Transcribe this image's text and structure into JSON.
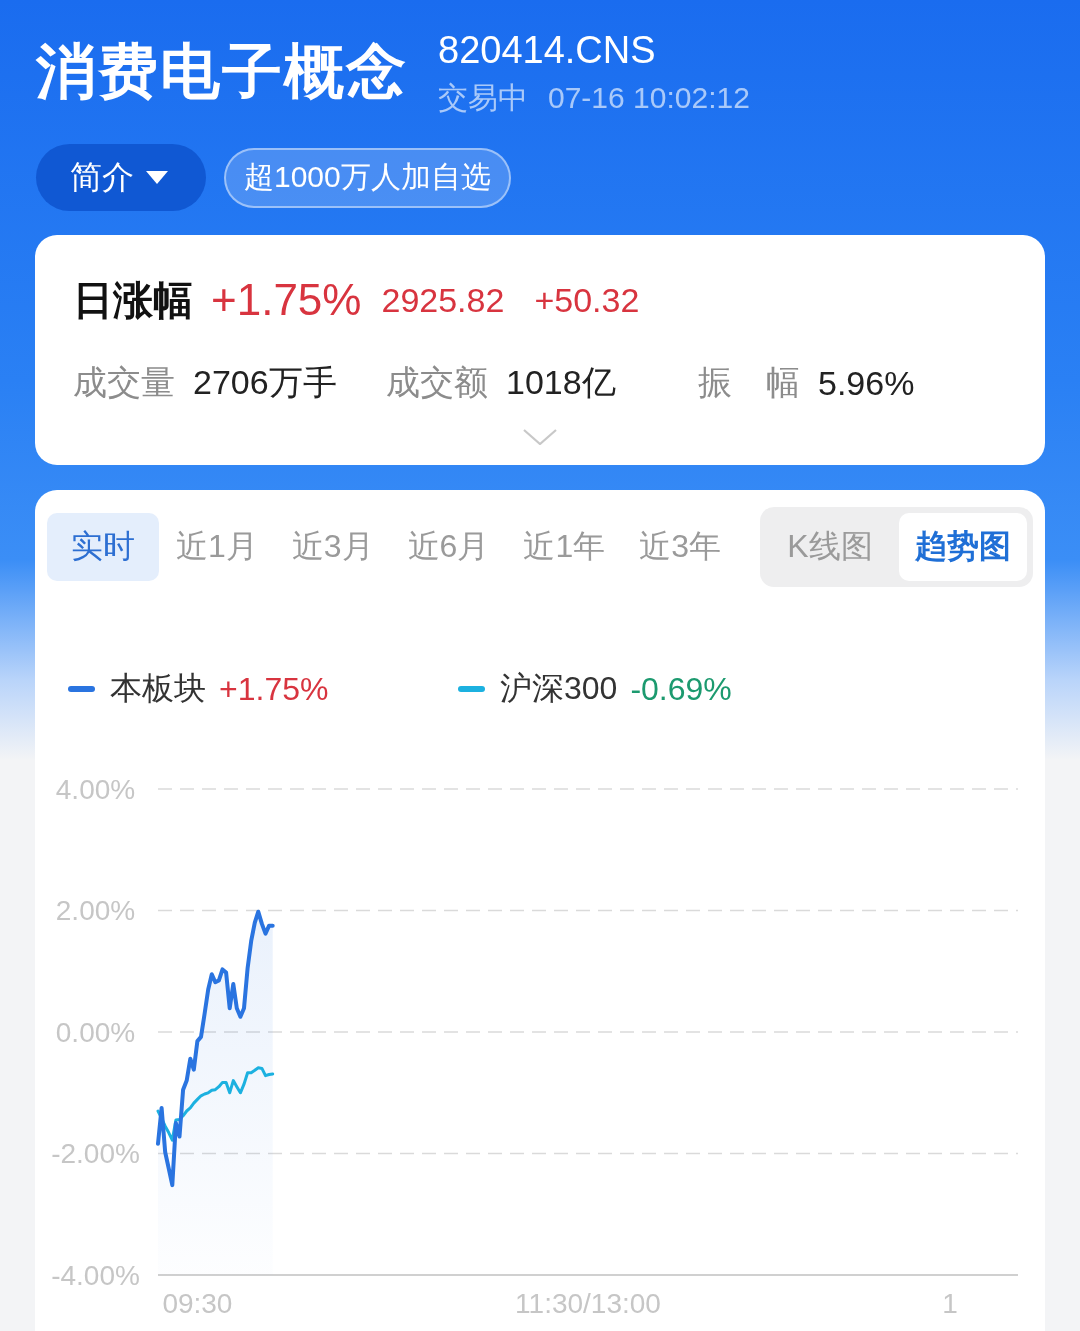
{
  "header": {
    "title": "消费电子概念",
    "code": "820414.CNS",
    "status": "交易中",
    "timestamp": "07-16 10:02:12"
  },
  "actions": {
    "intro_button": "简介",
    "watchlist_badge": "超1000万人加自选"
  },
  "quote": {
    "label": "日涨幅",
    "change_percent": "+1.75%",
    "price": "2925.82",
    "change": "+50.32",
    "color": "#d8343f",
    "stats": [
      {
        "label": "成交量",
        "value": "2706万手"
      },
      {
        "label": "成交额",
        "value": "1018亿"
      },
      {
        "label": "振　幅",
        "value": "5.96%"
      }
    ],
    "expanded": false
  },
  "chart": {
    "range_tabs": [
      {
        "label": "实时",
        "selected": true
      },
      {
        "label": "近1月",
        "selected": false
      },
      {
        "label": "近3月",
        "selected": false
      },
      {
        "label": "近6月",
        "selected": false
      },
      {
        "label": "近1年",
        "selected": false
      },
      {
        "label": "近3年",
        "selected": false
      }
    ],
    "view_toggle": [
      {
        "label": "K线图",
        "selected": false
      },
      {
        "label": "趋势图",
        "selected": true
      }
    ],
    "legend_changes": [
      {
        "text": "+1.75%",
        "color": "#d8343f"
      },
      {
        "text": "-0.69%",
        "color": "#1c9a6f"
      }
    ],
    "chart_data": {
      "type": "line",
      "grid": true,
      "categories": [
        null,
        null,
        null,
        null,
        null,
        null,
        null,
        null,
        null,
        null,
        null,
        "09:30",
        null,
        null,
        null,
        null,
        null,
        null,
        null,
        null,
        null,
        null,
        null,
        null,
        null,
        null,
        null,
        null,
        null,
        null,
        null,
        null,
        null,
        null,
        null,
        null,
        null,
        null,
        null,
        null,
        null,
        null,
        null,
        null,
        null,
        null,
        null,
        null,
        null,
        null,
        null,
        null,
        null,
        null,
        null,
        null,
        null,
        null,
        null,
        null,
        null,
        null,
        null,
        null,
        null,
        null,
        null,
        null,
        null,
        null,
        null,
        null,
        null,
        null,
        null,
        null,
        null,
        null,
        null,
        null,
        null,
        null,
        null,
        null,
        null,
        null,
        null,
        null,
        null,
        null,
        null,
        null,
        null,
        null,
        null,
        null,
        null,
        null,
        null,
        null,
        null,
        null,
        null,
        null,
        null,
        null,
        null,
        null,
        null,
        null,
        null,
        null,
        null,
        null,
        null,
        null,
        null,
        null,
        null,
        null,
        "11:30/13:00",
        null,
        null,
        null,
        null,
        null,
        null,
        null,
        null,
        null,
        null,
        null,
        null,
        null,
        null,
        null,
        null,
        null,
        null,
        null,
        null,
        null,
        null,
        null,
        null,
        null,
        null,
        null,
        null,
        null,
        null,
        null,
        null,
        null,
        null,
        null,
        null,
        null,
        null,
        null,
        null,
        null,
        null,
        null,
        null,
        null,
        null,
        null,
        null,
        null,
        null,
        null,
        null,
        null,
        null,
        null,
        null,
        null,
        null,
        null,
        null,
        null,
        null,
        null,
        null,
        null,
        null,
        null,
        null,
        null,
        null,
        null,
        null,
        null,
        null,
        null,
        null,
        null,
        null,
        null,
        null,
        null,
        null,
        null,
        null,
        null,
        null,
        null,
        null,
        null,
        null,
        null,
        null,
        null,
        null,
        null,
        null,
        null,
        null,
        null,
        null,
        "1",
        null,
        null,
        null,
        null,
        null,
        null,
        null,
        null,
        null,
        null,
        null,
        null,
        null,
        null,
        null,
        null,
        null,
        null,
        null
      ],
      "ylim": [
        -4,
        4
      ],
      "yticks": [
        {
          "value": 4,
          "label": "4.00%"
        },
        {
          "value": 2,
          "label": "2.00%"
        },
        {
          "value": 0,
          "label": "0.00%"
        },
        {
          "value": -2,
          "label": "-2.00%"
        },
        {
          "value": -4,
          "label": "-4.00%"
        }
      ],
      "series": [
        {
          "name": "本板块",
          "color": "#2a74e0",
          "values": [
            -1.84,
            -1.25,
            -1.98,
            -2.25,
            -2.52,
            -1.5,
            -1.72,
            -0.95,
            -0.8,
            -0.44,
            -0.62,
            -0.15,
            -0.08,
            0.3,
            0.7,
            0.95,
            0.82,
            0.85,
            1.03,
            0.98,
            0.39,
            0.79,
            0.39,
            0.25,
            0.39,
            1.05,
            1.5,
            1.8,
            1.98,
            1.78,
            1.62,
            1.75,
            1.75,
            null,
            null,
            null,
            null,
            null,
            null,
            null,
            null,
            null,
            null,
            null,
            null,
            null,
            null,
            null,
            null,
            null,
            null,
            null,
            null,
            null,
            null,
            null,
            null,
            null,
            null,
            null,
            null,
            null,
            null,
            null,
            null,
            null,
            null,
            null,
            null,
            null,
            null,
            null,
            null,
            null,
            null,
            null,
            null,
            null,
            null,
            null,
            null,
            null,
            null,
            null,
            null,
            null,
            null,
            null,
            null,
            null,
            null,
            null,
            null,
            null,
            null,
            null,
            null,
            null,
            null,
            null,
            null,
            null,
            null,
            null,
            null,
            null,
            null,
            null,
            null,
            null,
            null,
            null,
            null,
            null,
            null,
            null,
            null,
            null,
            null,
            null,
            null,
            null,
            null,
            null,
            null,
            null,
            null,
            null,
            null,
            null,
            null,
            null,
            null,
            null,
            null,
            null,
            null,
            null,
            null,
            null,
            null,
            null,
            null,
            null,
            null,
            null,
            null,
            null,
            null,
            null,
            null,
            null,
            null,
            null,
            null,
            null,
            null,
            null,
            null,
            null,
            null,
            null,
            null,
            null,
            null,
            null,
            null,
            null,
            null,
            null,
            null,
            null,
            null,
            null,
            null,
            null,
            null,
            null,
            null,
            null,
            null,
            null,
            null,
            null,
            null,
            null,
            null,
            null,
            null,
            null,
            null,
            null,
            null,
            null,
            null,
            null,
            null,
            null,
            null,
            null,
            null,
            null,
            null,
            null,
            null,
            null,
            null,
            null,
            null,
            null,
            null,
            null,
            null,
            null,
            null,
            null,
            null,
            null,
            null,
            null,
            null,
            null,
            null,
            null,
            null,
            null,
            null,
            null,
            null,
            null,
            null,
            null,
            null,
            null,
            null,
            null,
            null,
            null,
            null,
            null,
            null
          ]
        },
        {
          "name": "沪深300",
          "color": "#1cb1e0",
          "values": [
            -1.3,
            -1.42,
            -1.55,
            -1.66,
            -1.78,
            -1.45,
            -1.44,
            -1.38,
            -1.3,
            -1.25,
            -1.17,
            -1.11,
            -1.05,
            -1.02,
            -1.0,
            -0.96,
            -0.95,
            -0.9,
            -0.83,
            -0.83,
            -1.0,
            -0.8,
            -0.9,
            -1.0,
            -0.86,
            -0.67,
            -0.67,
            -0.63,
            -0.59,
            -0.6,
            -0.72,
            -0.7,
            -0.69,
            null,
            null,
            null,
            null,
            null,
            null,
            null,
            null,
            null,
            null,
            null,
            null,
            null,
            null,
            null,
            null,
            null,
            null,
            null,
            null,
            null,
            null,
            null,
            null,
            null,
            null,
            null,
            null,
            null,
            null,
            null,
            null,
            null,
            null,
            null,
            null,
            null,
            null,
            null,
            null,
            null,
            null,
            null,
            null,
            null,
            null,
            null,
            null,
            null,
            null,
            null,
            null,
            null,
            null,
            null,
            null,
            null,
            null,
            null,
            null,
            null,
            null,
            null,
            null,
            null,
            null,
            null,
            null,
            null,
            null,
            null,
            null,
            null,
            null,
            null,
            null,
            null,
            null,
            null,
            null,
            null,
            null,
            null,
            null,
            null,
            null,
            null,
            null,
            null,
            null,
            null,
            null,
            null,
            null,
            null,
            null,
            null,
            null,
            null,
            null,
            null,
            null,
            null,
            null,
            null,
            null,
            null,
            null,
            null,
            null,
            null,
            null,
            null,
            null,
            null,
            null,
            null,
            null,
            null,
            null,
            null,
            null,
            null,
            null,
            null,
            null,
            null,
            null,
            null,
            null,
            null,
            null,
            null,
            null,
            null,
            null,
            null,
            null,
            null,
            null,
            null,
            null,
            null,
            null,
            null,
            null,
            null,
            null,
            null,
            null,
            null,
            null,
            null,
            null,
            null,
            null,
            null,
            null,
            null,
            null,
            null,
            null,
            null,
            null,
            null,
            null,
            null,
            null,
            null,
            null,
            null,
            null,
            null,
            null,
            null,
            null,
            null,
            null,
            null,
            null,
            null,
            null,
            null,
            null,
            null,
            null,
            null,
            null,
            null,
            null,
            null,
            null,
            null,
            null,
            null,
            null,
            null,
            null,
            null,
            null,
            null,
            null,
            null,
            null,
            null,
            null,
            null,
            null
          ]
        }
      ]
    }
  }
}
